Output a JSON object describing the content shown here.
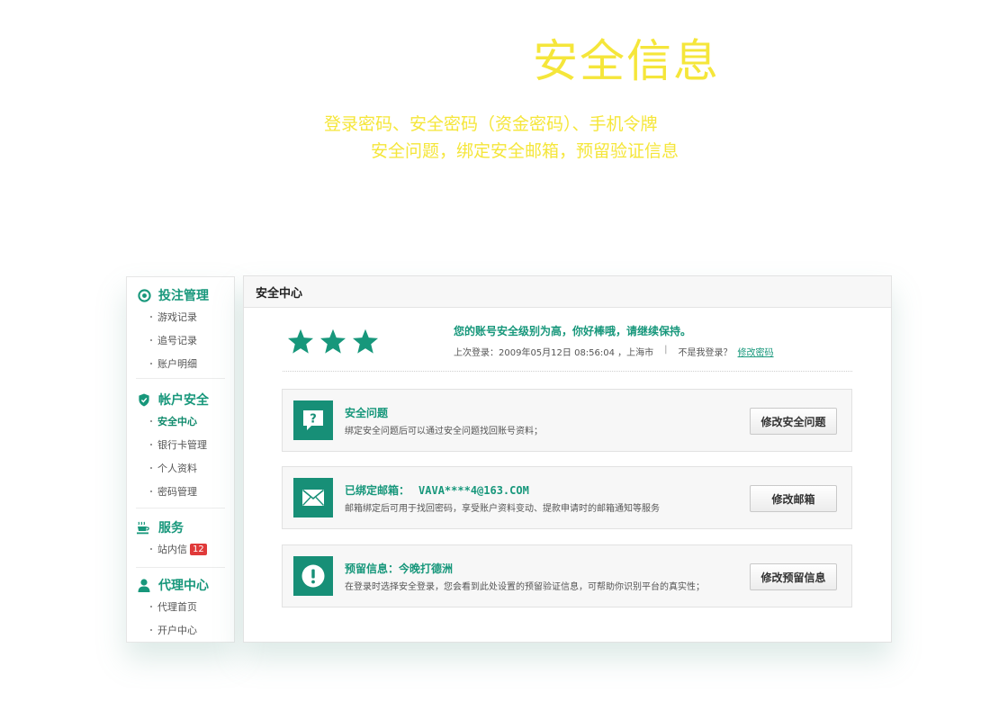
{
  "hero": {
    "title": "安全信息",
    "line1": "登录密码、安全密码（资金密码）、手机令牌",
    "line2": "安全问题，绑定安全邮箱，预留验证信息"
  },
  "sidebar": {
    "groups": [
      {
        "title": "投注管理",
        "icon": "target-icon",
        "items": [
          {
            "label": "游戏记录"
          },
          {
            "label": "追号记录"
          },
          {
            "label": "账户明细"
          }
        ]
      },
      {
        "title": "帐户安全",
        "icon": "shield-icon",
        "items": [
          {
            "label": "安全中心",
            "active": true
          },
          {
            "label": "银行卡管理"
          },
          {
            "label": "个人资料"
          },
          {
            "label": "密码管理"
          }
        ]
      },
      {
        "title": "服务",
        "icon": "cup-icon",
        "items": [
          {
            "label": "站内信",
            "badge": "12"
          }
        ]
      },
      {
        "title": "代理中心",
        "icon": "user-icon",
        "items": [
          {
            "label": "代理首页"
          },
          {
            "label": "开户中心"
          }
        ]
      }
    ]
  },
  "panel": {
    "title": "安全中心",
    "star_rating": {
      "filled": 3,
      "total": 3
    },
    "level_message": "您的账号安全级别为高，你好棒哦，请继续保持。",
    "last_login": {
      "label": "上次登录：2009年05月12日 08:56:04 ，上海市",
      "not_me": "不是我登录？",
      "change_password": "修改密码"
    },
    "cards": [
      {
        "icon": "question-chat-icon",
        "title": "安全问题",
        "value": "",
        "desc": "绑定安全问题后可以通过安全问题找回账号资料；",
        "button": "修改安全问题"
      },
      {
        "icon": "mail-icon",
        "title": "已绑定邮箱：",
        "value": "VAVA****4@163.COM",
        "desc": "邮箱绑定后可用于找回密码，享受账户资料变动、提款申请时的邮箱通知等服务",
        "button": "修改邮箱"
      },
      {
        "icon": "alert-icon",
        "title": "预留信息：今晚打德洲",
        "value": "",
        "desc": "在登录时选择安全登录，您会看到此处设置的预留验证信息，可帮助你识别平台的真实性；",
        "button": "修改预留信息"
      }
    ]
  },
  "colors": {
    "accent": "#17977b",
    "hero": "#f5e63a",
    "badge": "#e03a3a"
  }
}
